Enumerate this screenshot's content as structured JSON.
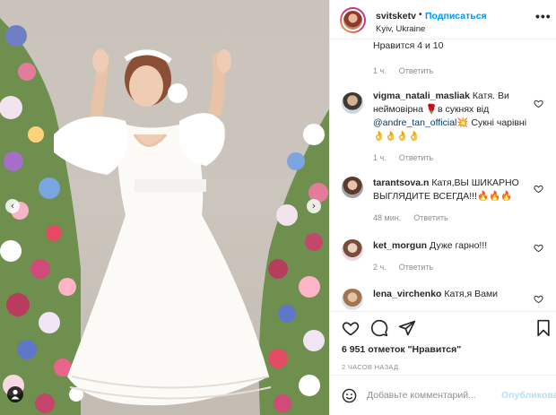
{
  "post": {
    "photo_alt": "",
    "nav": {
      "prev_icon": "chevron-left-icon",
      "next_icon": "chevron-right-icon"
    },
    "tag_icon": "person-tag-icon"
  },
  "header": {
    "username": "svitsketv",
    "separator": "•",
    "follow_label": "Подписаться",
    "location": "Kyiv, Ukraine",
    "more_icon": "ellipsis-icon"
  },
  "comments": [
    {
      "text": "Нравится 4 и 10",
      "time": "1 ч.",
      "reply": "Ответить"
    },
    {
      "username": "vigma_natali_masliak",
      "text_a": "Катя. Ви неймовірна",
      "emoji_a": "🌹",
      "text_b": "в сукнях від",
      "mention": "@andre_tan_official",
      "emoji_b": "💥",
      "text_c": "Сукні чарівні",
      "emoji_c": "👌👌👌👌",
      "time": "1 ч.",
      "reply": "Ответить"
    },
    {
      "username": "tarantsova.n",
      "text": "Катя,ВЫ ШИКАРНО ВЫГЛЯДИТЕ ВСЕГДА!!!",
      "emoji": "🔥🔥🔥",
      "time": "48 мин.",
      "reply": "Ответить"
    },
    {
      "username": "ket_morgun",
      "text": "Дуже гарно!!!",
      "time": "2 ч.",
      "reply": "Ответить"
    },
    {
      "username": "lena_virchenko",
      "text": "Катя,я Вами"
    }
  ],
  "actions": {
    "like_icon": "heart-icon",
    "comment_icon": "comment-icon",
    "share_icon": "paper-plane-icon",
    "save_icon": "bookmark-icon"
  },
  "likes": "6 951 отметок \"Нравится\"",
  "time_ago": "2 ЧАСОВ НАЗАД",
  "add_comment": {
    "emoji_icon": "smiley-icon",
    "placeholder": "Добавьте комментарий...",
    "post_label": "Опубликовать"
  },
  "colors": {
    "link_blue": "#0095f6",
    "post_disabled": "#b2dffc",
    "secondary_text": "#8e8e8e",
    "dress_white": "#fbfaf7",
    "background_wall": "#c9c3bb"
  }
}
